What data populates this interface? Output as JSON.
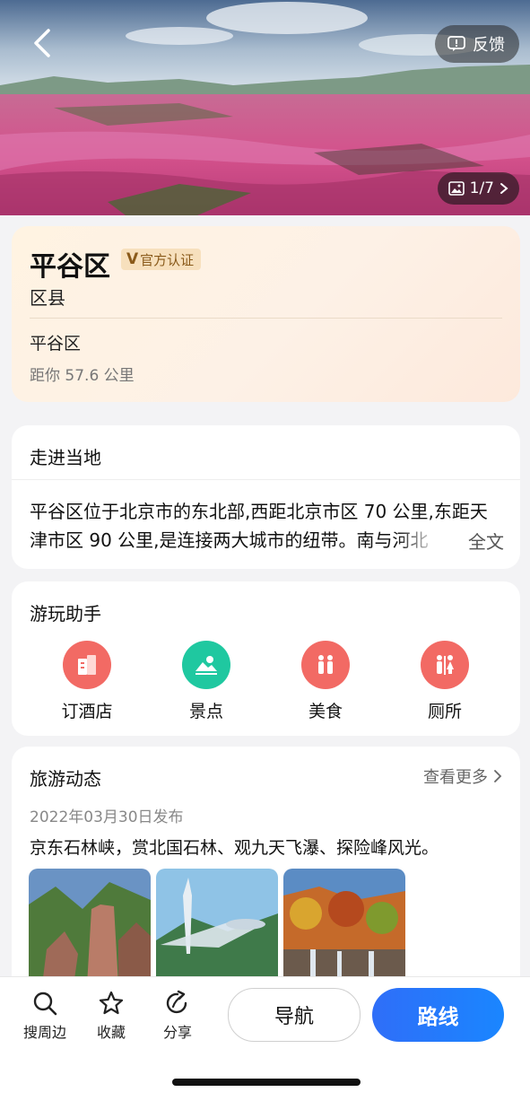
{
  "hero": {
    "feedback_label": "反馈",
    "photo_counter": "1/7"
  },
  "poi": {
    "name": "平谷区",
    "verified_mark": "V",
    "verified_label": "官方认证",
    "category": "区县",
    "address": "平谷区",
    "distance": "距你 57.6 公里"
  },
  "intro": {
    "title": "走进当地",
    "text": "平谷区位于北京市的东北部,西距北京市区 70 公里,东距天津市区 90 公里,是连接两大城市的纽带。南与河北",
    "full_text_label": "全文"
  },
  "assistant": {
    "title": "游玩助手",
    "items": [
      {
        "label": "订酒店",
        "icon": "hotel-icon",
        "color": "#f26a64"
      },
      {
        "label": "景点",
        "icon": "scenic-icon",
        "color": "#1fc8a0"
      },
      {
        "label": "美食",
        "icon": "food-icon",
        "color": "#f26a64"
      },
      {
        "label": "厕所",
        "icon": "toilet-icon",
        "color": "#f26a64"
      }
    ]
  },
  "news": {
    "title": "旅游动态",
    "more_label": "查看更多",
    "date": "2022年03月30日发布",
    "headline": "京东石林峡，赏北国石林、观九天飞瀑、探险峰风光。"
  },
  "bottom_bar": {
    "tools": [
      {
        "label": "搜周边",
        "icon": "search-icon"
      },
      {
        "label": "收藏",
        "icon": "star-icon"
      },
      {
        "label": "分享",
        "icon": "share-icon"
      }
    ],
    "nav_label": "导航",
    "route_label": "路线"
  },
  "colors": {
    "accent_blue": "#1a7cff",
    "verified_bg": "#f7e0bd",
    "scenic_green": "#1fc8a0",
    "poi_red": "#f26a64"
  }
}
